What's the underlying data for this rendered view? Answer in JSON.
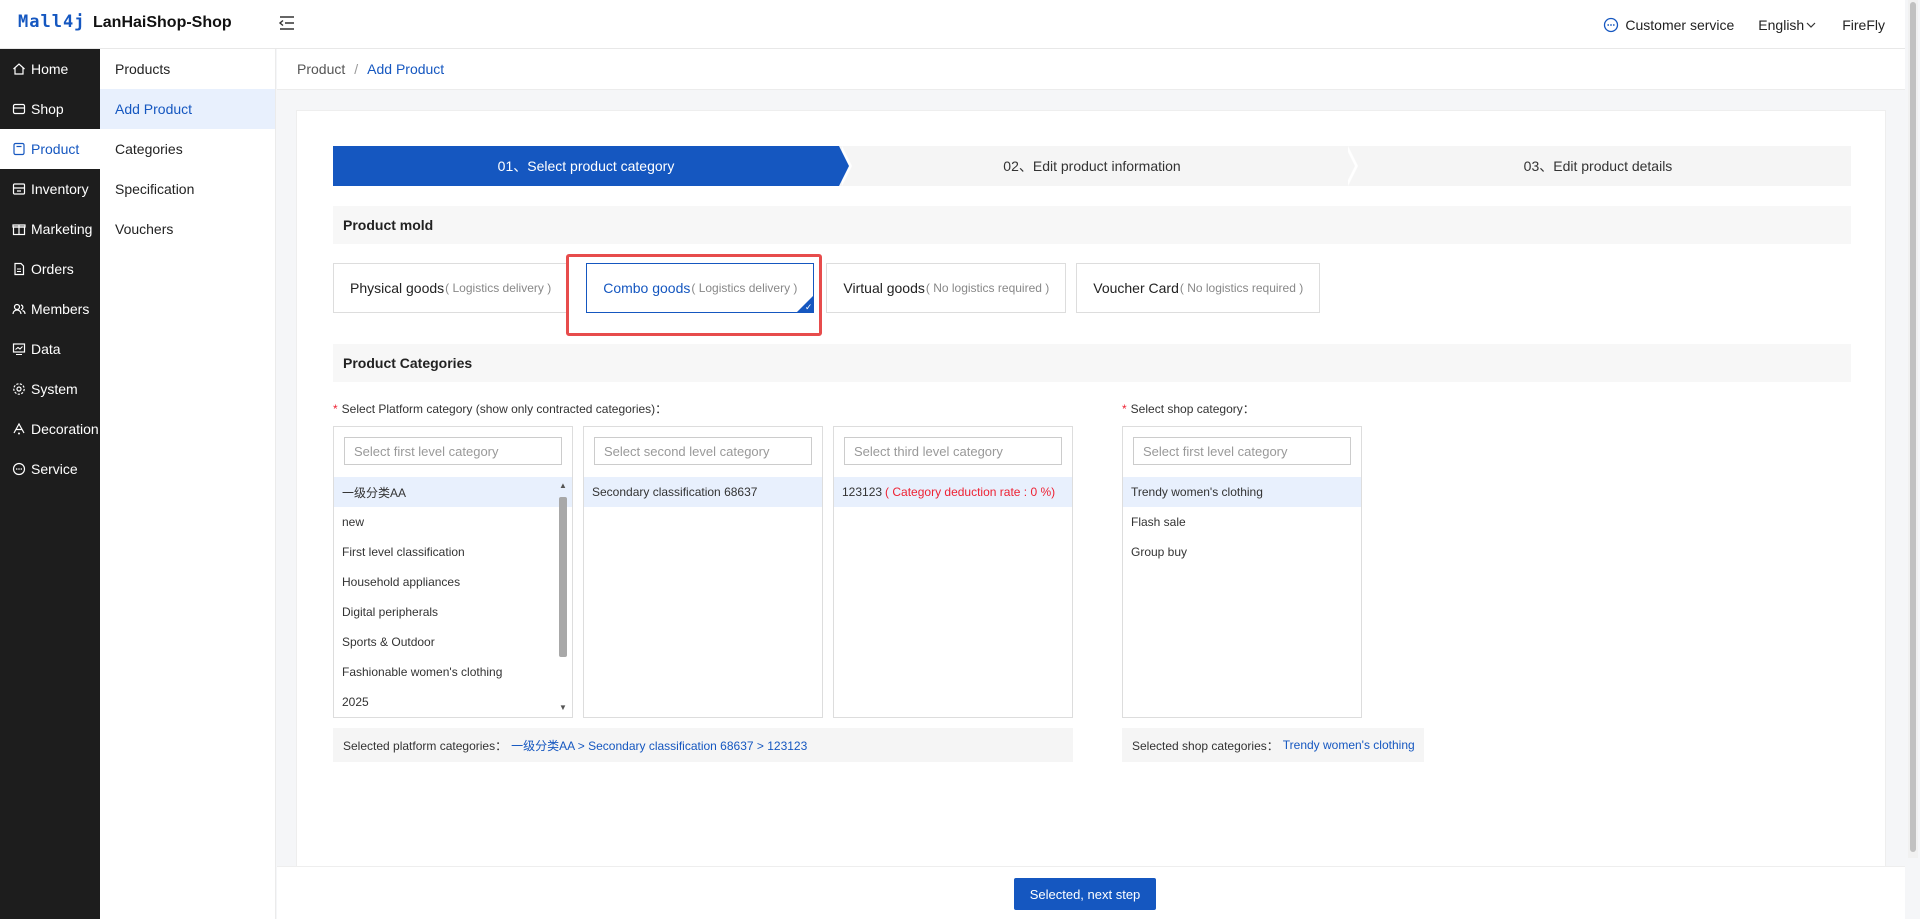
{
  "header": {
    "logo": "Mall4j",
    "shop_name": "LanHaiShop-Shop",
    "customer_service": "Customer service",
    "language": "English",
    "user": "FireFly"
  },
  "sidebar": {
    "items": [
      {
        "label": "Home",
        "icon": "home-icon"
      },
      {
        "label": "Shop",
        "icon": "shop-icon"
      },
      {
        "label": "Product",
        "icon": "product-icon"
      },
      {
        "label": "Inventory",
        "icon": "inventory-icon"
      },
      {
        "label": "Marketing",
        "icon": "marketing-icon"
      },
      {
        "label": "Orders",
        "icon": "orders-icon"
      },
      {
        "label": "Members",
        "icon": "members-icon"
      },
      {
        "label": "Data",
        "icon": "data-icon"
      },
      {
        "label": "System",
        "icon": "system-icon"
      },
      {
        "label": "Decoration",
        "icon": "decoration-icon"
      },
      {
        "label": "Service",
        "icon": "service-icon"
      }
    ]
  },
  "submenu": {
    "items": [
      "Products",
      "Add Product",
      "Categories",
      "Specification",
      "Vouchers"
    ]
  },
  "breadcrumb": {
    "parent": "Product",
    "sep": "/",
    "current": "Add Product"
  },
  "steps": [
    "01、Select product category",
    "02、Edit product information",
    "03、Edit product details"
  ],
  "mold": {
    "title": "Product mold",
    "options": [
      {
        "name": "Physical goods",
        "hint": "( Logistics delivery )"
      },
      {
        "name": "Combo goods",
        "hint": "( Logistics delivery )"
      },
      {
        "name": "Virtual goods",
        "hint": "( No logistics required )"
      },
      {
        "name": "Voucher Card",
        "hint": "( No logistics required )"
      }
    ]
  },
  "categories": {
    "title": "Product Categories",
    "platform_label": "Select Platform category (show only contracted categories)：",
    "shop_label": "Select shop category：",
    "req": "*",
    "first_placeholder": "Select first level category",
    "second_placeholder": "Select second level category",
    "third_placeholder": "Select third level category",
    "shop_placeholder": "Select first level category",
    "first_level": [
      "一级分类AA",
      "new",
      "First level classification",
      "Household appliances",
      "Digital peripherals",
      "Sports & Outdoor",
      "Fashionable women's clothing",
      "2025"
    ],
    "second_level": [
      "Secondary classification 68637"
    ],
    "third_level": {
      "name": "123123",
      "rate": "( Category deduction rate : 0 %)"
    },
    "shop_level": [
      "Trendy women's clothing",
      "Flash sale",
      "Group buy"
    ],
    "selected_platform_label": "Selected platform categories：",
    "selected_platform_path": "一级分类AA >  Secondary classification 68637 >  123123",
    "selected_shop_label": "Selected shop categories：",
    "selected_shop_path": "Trendy women's clothing"
  },
  "footer": {
    "next_label": "Selected, next step"
  }
}
